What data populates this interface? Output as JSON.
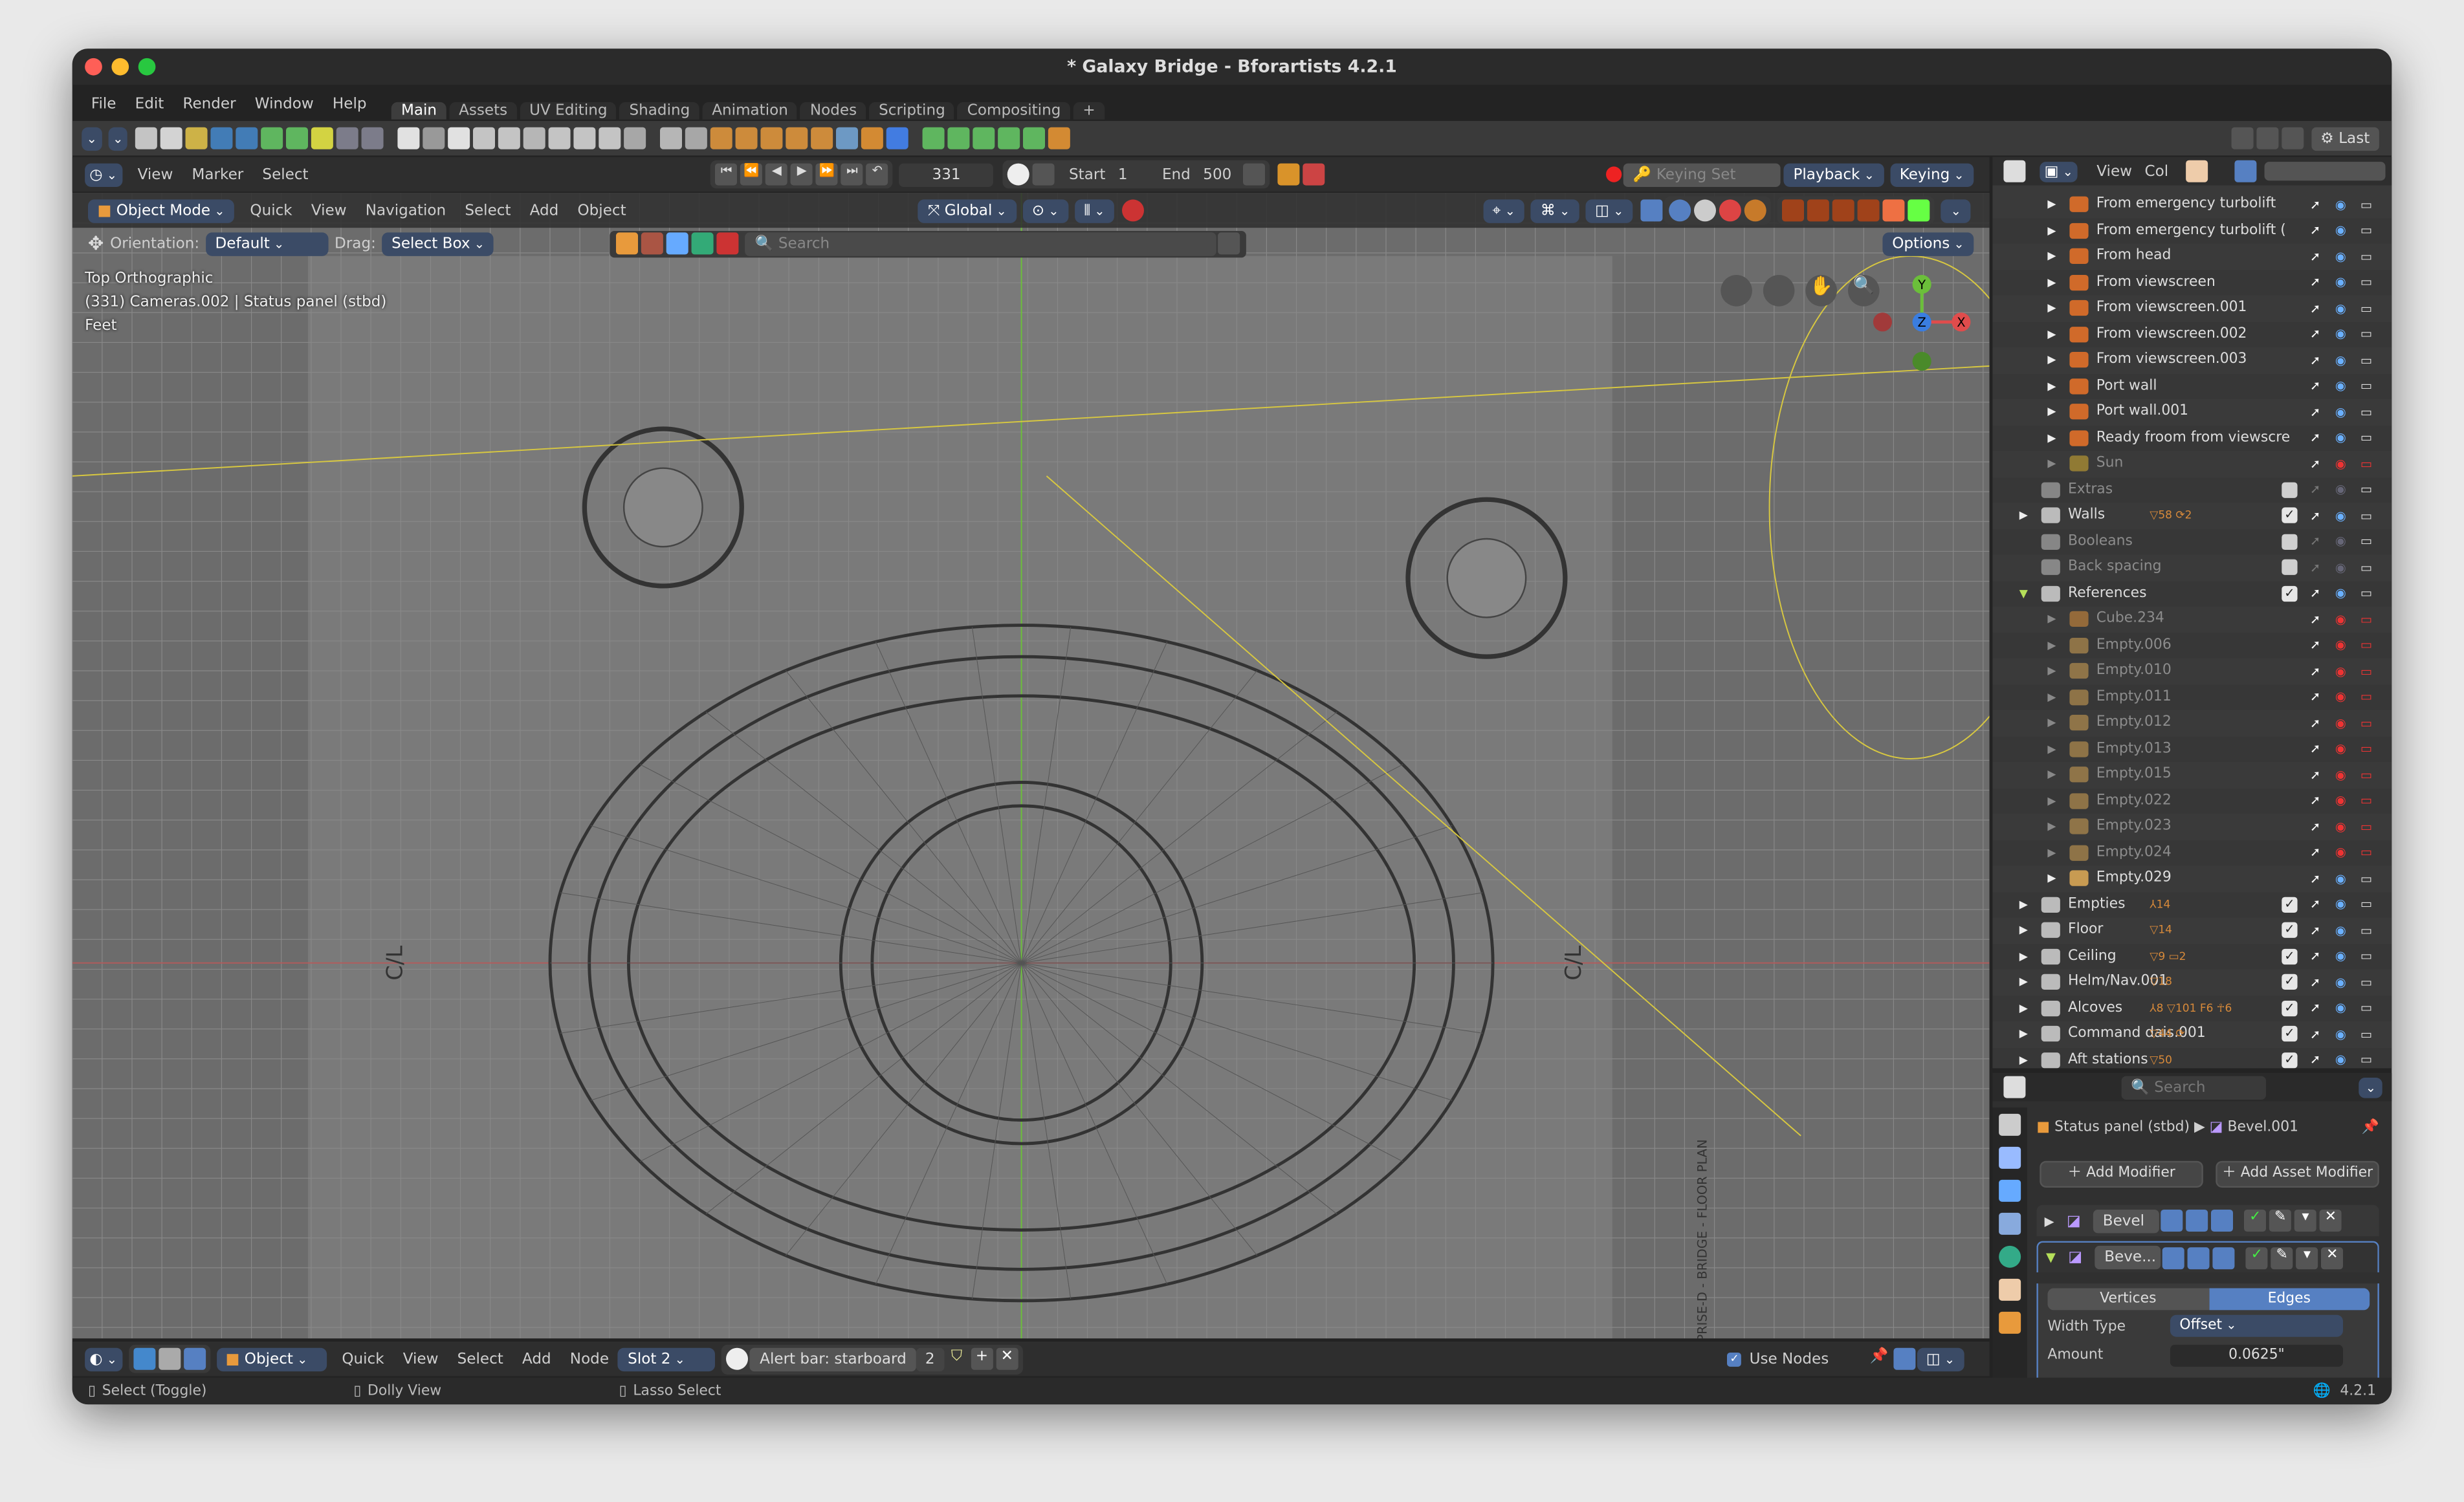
{
  "window": {
    "title": "* Galaxy Bridge - Bforartists 4.2.1"
  },
  "menu": [
    "File",
    "Edit",
    "Render",
    "Window",
    "Help"
  ],
  "workspaces": [
    {
      "label": "Main",
      "active": true
    },
    {
      "label": "Assets"
    },
    {
      "label": "UV Editing"
    },
    {
      "label": "Shading"
    },
    {
      "label": "Animation"
    },
    {
      "label": "Nodes"
    },
    {
      "label": "Scripting"
    },
    {
      "label": "Compositing"
    },
    {
      "label": "+"
    }
  ],
  "toolbar": {
    "icons": [
      "new-file-icon",
      "open-file-icon",
      "recent-file-icon",
      "save-icon",
      "save-as-icon",
      "save-copy-icon",
      "import-icon",
      "export-icon",
      "render-icon",
      "render-animation-icon",
      "plane-icon",
      "cube-icon",
      "sphere-icon",
      "uv-sphere-icon",
      "icosphere-icon",
      "cylinder-icon",
      "cone-icon",
      "torus-icon",
      "grid-icon",
      "empty-icon",
      "curve-icon",
      "monkey-icon",
      "text-icon",
      "armature-icon",
      "lattice-icon",
      "camera-icon",
      "speaker-icon",
      "light-probe-icon",
      "material-icon",
      "node-icon",
      "apply-icon",
      "apply-rotation-icon",
      "apply-scale-icon",
      "apply-all-icon",
      "apply-visual-icon",
      "apply-parent-icon"
    ],
    "right": {
      "last_label": "Last"
    }
  },
  "timeline": {
    "menus": [
      "View",
      "Marker",
      "Select"
    ],
    "current_frame": "331",
    "start_label": "Start",
    "start": "1",
    "end_label": "End",
    "end": "500",
    "keying_set_placeholder": "Keying Set",
    "playback": "Playback",
    "keying": "Keying"
  },
  "viewport_header": {
    "mode": "Object Mode",
    "menus": [
      "Quick",
      "View",
      "Navigation",
      "Select",
      "Add",
      "Object"
    ],
    "transform_orientation": "Global"
  },
  "tool_settings": {
    "orientation_label": "Orientation:",
    "orientation": "Default",
    "drag_label": "Drag:",
    "drag": "Select Box",
    "search_placeholder": "Search",
    "options": "Options"
  },
  "viewport": {
    "view_name": "Top Orthographic",
    "context": "(331) Cameras.002 | Status panel (stbd)",
    "units": "Feet",
    "gizmo": {
      "x": "X",
      "y": "Y",
      "z": "Z"
    },
    "blueprint_labels": [
      "C/L",
      "C/L",
      "ENTERPRISE-D - BRIDGE - FLOOR PLAN"
    ]
  },
  "outliner": {
    "header": {
      "view": "View",
      "col": "Col"
    },
    "rows": [
      {
        "label": "From emergency turbolift",
        "type": "camera",
        "indent": 2
      },
      {
        "label": "From emergency turbolift (",
        "type": "camera",
        "indent": 2
      },
      {
        "label": "From head",
        "type": "camera",
        "indent": 2
      },
      {
        "label": "From viewscreen",
        "type": "camera",
        "indent": 2
      },
      {
        "label": "From viewscreen.001",
        "type": "camera",
        "indent": 2
      },
      {
        "label": "From viewscreen.002",
        "type": "camera",
        "indent": 2
      },
      {
        "label": "From viewscreen.003",
        "type": "camera",
        "indent": 2
      },
      {
        "label": "Port wall",
        "type": "camera",
        "indent": 2
      },
      {
        "label": "Port wall.001",
        "type": "camera",
        "indent": 2
      },
      {
        "label": "Ready froom from viewscre",
        "type": "camera",
        "indent": 2
      },
      {
        "label": "Sun",
        "type": "light",
        "indent": 2,
        "dim": true,
        "hidden": true
      },
      {
        "label": "Extras",
        "type": "collection",
        "indent": 1,
        "dim": true,
        "check": false,
        "noarrow": true
      },
      {
        "label": "Walls",
        "type": "collection",
        "indent": 1,
        "check": true,
        "extra": "▽58 ⟳2"
      },
      {
        "label": "Booleans",
        "type": "collection",
        "indent": 1,
        "dim": true,
        "check": false,
        "noarrow": true
      },
      {
        "label": "Back spacing",
        "type": "collection",
        "indent": 1,
        "dim": true,
        "check": false,
        "noarrow": true
      },
      {
        "label": "References",
        "type": "collection",
        "indent": 1,
        "check": true,
        "expanded": true
      },
      {
        "label": "Cube.234",
        "type": "mesh",
        "indent": 2,
        "dim": true,
        "hidden": true
      },
      {
        "label": "Empty.006",
        "type": "image",
        "indent": 2,
        "dim": true,
        "hidden": true
      },
      {
        "label": "Empty.010",
        "type": "image",
        "indent": 2,
        "dim": true,
        "hidden": true
      },
      {
        "label": "Empty.011",
        "type": "image",
        "indent": 2,
        "dim": true,
        "hidden": true
      },
      {
        "label": "Empty.012",
        "type": "image",
        "indent": 2,
        "dim": true,
        "hidden": true
      },
      {
        "label": "Empty.013",
        "type": "image",
        "indent": 2,
        "dim": true,
        "hidden": true
      },
      {
        "label": "Empty.015",
        "type": "image",
        "indent": 2,
        "dim": true,
        "hidden": true
      },
      {
        "label": "Empty.022",
        "type": "image",
        "indent": 2,
        "dim": true,
        "hidden": true
      },
      {
        "label": "Empty.023",
        "type": "image",
        "indent": 2,
        "dim": true,
        "hidden": true
      },
      {
        "label": "Empty.024",
        "type": "image",
        "indent": 2,
        "dim": true,
        "hidden": true
      },
      {
        "label": "Empty.029",
        "type": "image",
        "indent": 2
      },
      {
        "label": "Empties",
        "type": "collection",
        "indent": 1,
        "check": true,
        "extra": "⅄14"
      },
      {
        "label": "Floor",
        "type": "collection",
        "indent": 1,
        "check": true,
        "extra": "▽14"
      },
      {
        "label": "Ceiling",
        "type": "collection",
        "indent": 1,
        "check": true,
        "extra": "▽9 ▭2"
      },
      {
        "label": "Helm/Nav.001",
        "type": "collection",
        "indent": 1,
        "check": true,
        "extra": "▽18"
      },
      {
        "label": "Alcoves",
        "type": "collection",
        "indent": 1,
        "check": true,
        "extra": "⅄8 ▽101 F6 ☥6"
      },
      {
        "label": "Command dais.001",
        "type": "collection",
        "indent": 1,
        "check": true,
        "extra": "▽44 ⟳"
      },
      {
        "label": "Aft stations",
        "type": "collection",
        "indent": 1,
        "check": true,
        "extra": "▽50"
      }
    ]
  },
  "properties": {
    "search_placeholder": "Search",
    "object": "Status panel (stbd)",
    "modifier": "Bevel.001",
    "add_modifier": "Add Modifier",
    "add_asset_modifier": "Add Asset Modifier",
    "modifiers": [
      {
        "name": "Bevel",
        "expanded": false
      },
      {
        "name": "Beve...",
        "expanded": true
      }
    ],
    "affect": {
      "options": [
        "Vertices",
        "Edges"
      ],
      "selected": "Edges"
    },
    "width_type_label": "Width Type",
    "width_type": "Offset",
    "amount_label": "Amount",
    "amount": "0.0625\""
  },
  "node_header": {
    "type": "Object",
    "menus": [
      "Quick",
      "View",
      "Select",
      "Add",
      "Node"
    ],
    "slot": "Slot 2",
    "material": "Alert bar: starboard",
    "users": "2",
    "use_nodes": "Use Nodes",
    "use_nodes_checked": true
  },
  "statusbar": {
    "hints": [
      "Select (Toggle)",
      "Dolly View",
      "Lasso Select"
    ],
    "version": "4.2.1"
  },
  "colors": {
    "accent": "#5680c2",
    "dropdown": "#3b4b66",
    "viewport_bg": "#6c6c6c",
    "x_axis": "#e04c4c",
    "y_axis": "#6bbf3a",
    "z_axis": "#3a7de0"
  }
}
